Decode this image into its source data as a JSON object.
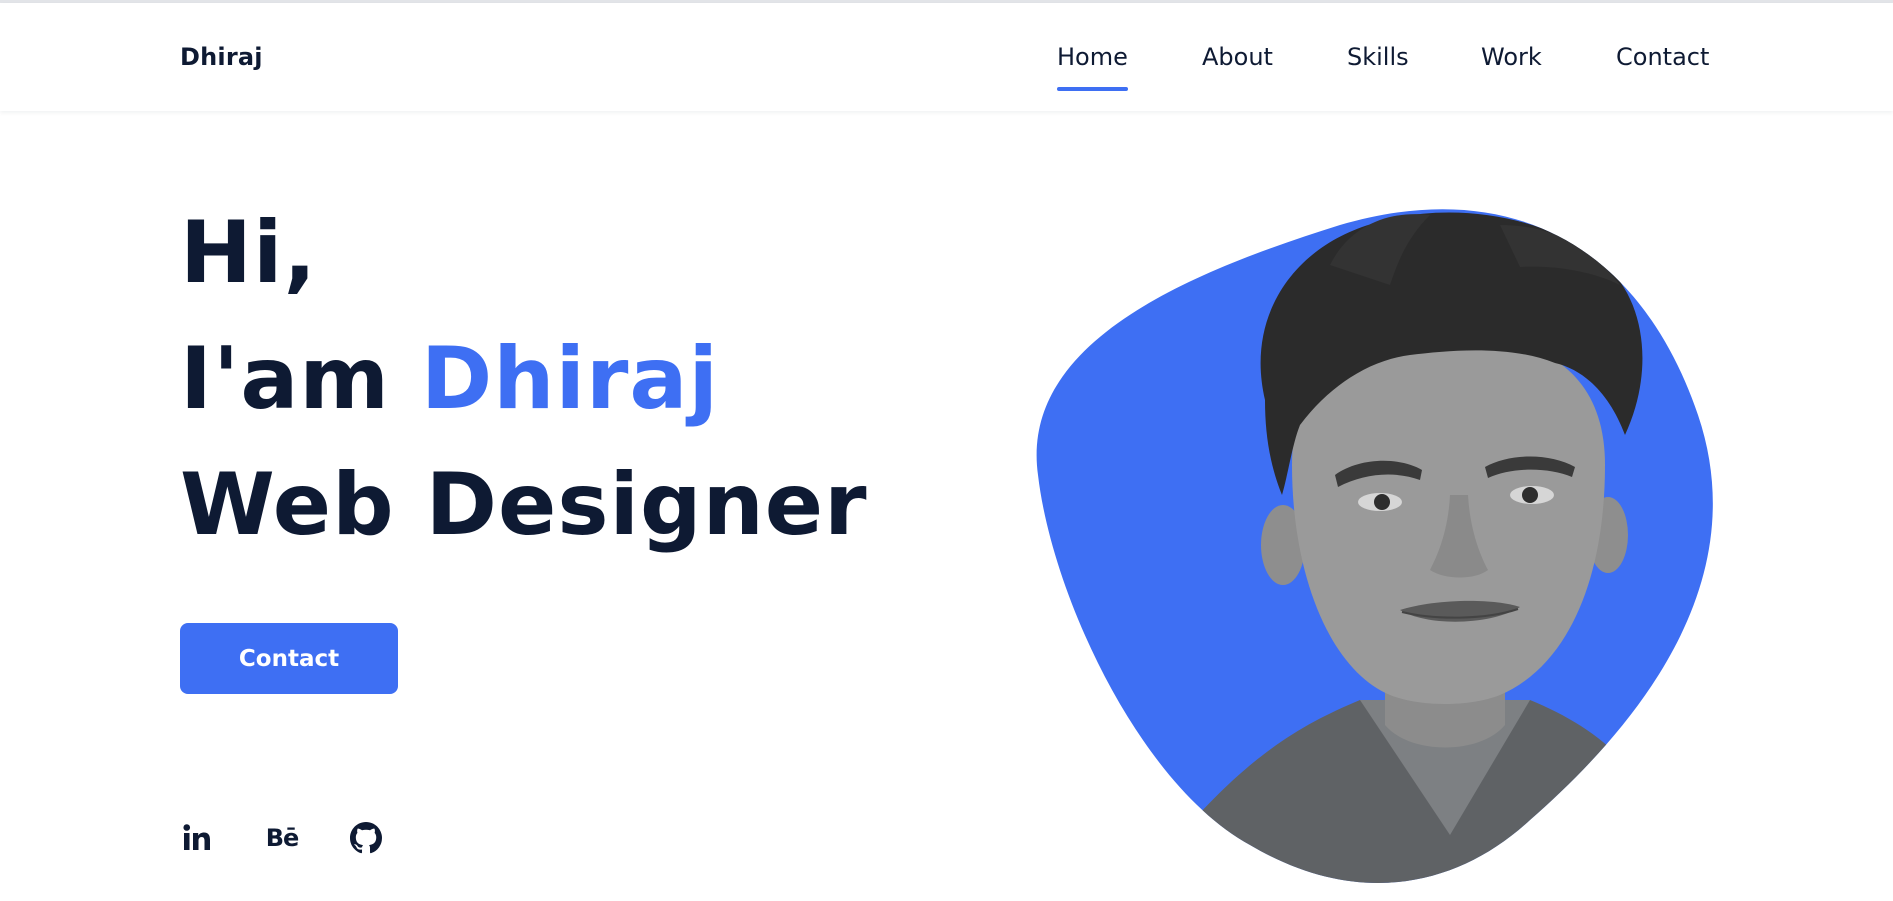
{
  "header": {
    "logo": "Dhiraj",
    "nav": [
      {
        "label": "Home",
        "active": true
      },
      {
        "label": "About",
        "active": false
      },
      {
        "label": "Skills",
        "active": false
      },
      {
        "label": "Work",
        "active": false
      },
      {
        "label": "Contact",
        "active": false
      }
    ]
  },
  "hero": {
    "line1": "Hi,",
    "line2_prefix": "I'am ",
    "line2_name": "Dhiraj",
    "line3": "Web Designer",
    "button_label": "Contact"
  },
  "social": {
    "linkedin_icon": "in",
    "behance_icon": "Bē",
    "icons": [
      "linkedin-icon",
      "behance-icon",
      "github-icon"
    ]
  },
  "colors": {
    "accent": "#3e6ff3",
    "text": "#0e1a33",
    "background": "#ffffff"
  }
}
